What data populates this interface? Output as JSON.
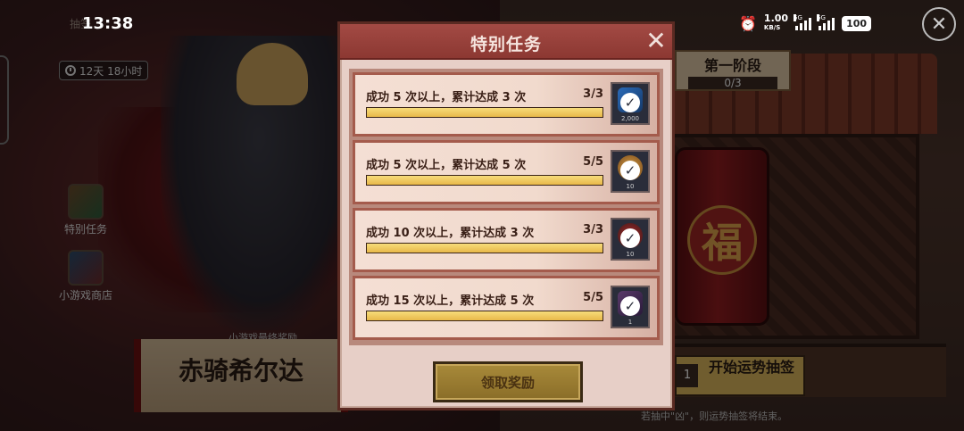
{
  "status_bar": {
    "time": "13:38",
    "net_speed_value": "1.00",
    "net_speed_unit": "KB/S",
    "signal1_label": "5G",
    "signal2_label": "5G",
    "battery": "100"
  },
  "top_title": "抽签",
  "timer": {
    "text": "12天 18小时"
  },
  "side_buttons": [
    {
      "label": "特别任务"
    },
    {
      "label": "小游戏商店"
    }
  ],
  "final_reward": {
    "label": "小游戏最终奖励",
    "hero_name": "赤骑希尔达"
  },
  "stage": {
    "title": "第一阶段",
    "progress": "0/3"
  },
  "draw": {
    "count": "1",
    "label": "开始运势抽签",
    "note": "若抽中\"凶\"，则运势抽签将结束。"
  },
  "modal": {
    "title": "特别任务",
    "close_label": "✕",
    "claim_label": "领取奖励",
    "tasks": [
      {
        "text": "成功 5 次以上，累计达成 3 次",
        "count": "3/3",
        "progress": 1.0,
        "reward_qty": "2,000",
        "reward_icon": "crystal-icon"
      },
      {
        "text": "成功 5 次以上，累计达成 5 次",
        "count": "5/5",
        "progress": 1.0,
        "reward_qty": "10",
        "reward_icon": "coin-icon"
      },
      {
        "text": "成功 10 次以上，累计达成 3 次",
        "count": "3/3",
        "progress": 1.0,
        "reward_qty": "10",
        "reward_icon": "rune-icon"
      },
      {
        "text": "成功 15 次以上，累计达成 5 次",
        "count": "5/5",
        "progress": 1.0,
        "reward_qty": "1",
        "reward_icon": "hero-portrait-icon"
      }
    ]
  },
  "colors": {
    "modal_header": "#9a423c",
    "progress_fill": "#eec35c",
    "claim_button": "#9a7c30"
  }
}
